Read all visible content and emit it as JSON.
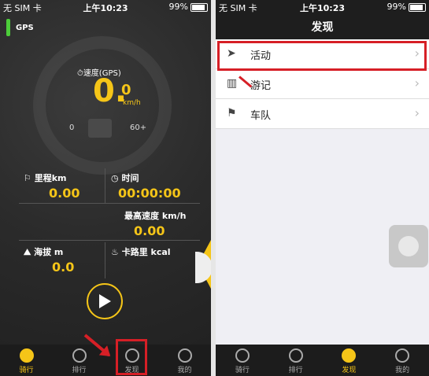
{
  "left": {
    "status": {
      "carrier": "无 SIM 卡",
      "time": "上午10:23",
      "battery": "99%"
    },
    "gps_label": "GPS",
    "speed": {
      "label": "速度(GPS)",
      "value": "0.",
      "decimal": "0",
      "unit": "km/h",
      "min": "0",
      "max": "60+"
    },
    "stats": [
      {
        "label": "里程km",
        "value": "0.00"
      },
      {
        "label": "时间",
        "value": "00:00:00"
      },
      {
        "label": "最高速度 km/h",
        "value": "0.00"
      },
      {
        "label": "海拔 m",
        "value": "0.0"
      },
      {
        "label": "卡路里 kcal",
        "value": "0"
      }
    ],
    "tabs": [
      {
        "label": "骑行"
      },
      {
        "label": "排行"
      },
      {
        "label": "发现"
      },
      {
        "label": "我的"
      }
    ]
  },
  "right": {
    "status": {
      "carrier": "无 SIM 卡",
      "time": "上午10:23",
      "battery": "99%"
    },
    "title": "发现",
    "rows": [
      {
        "label": "活动"
      },
      {
        "label": "游记"
      },
      {
        "label": "车队"
      }
    ],
    "tabs": [
      {
        "label": "骑行"
      },
      {
        "label": "排行"
      },
      {
        "label": "发现"
      },
      {
        "label": "我的"
      }
    ]
  }
}
